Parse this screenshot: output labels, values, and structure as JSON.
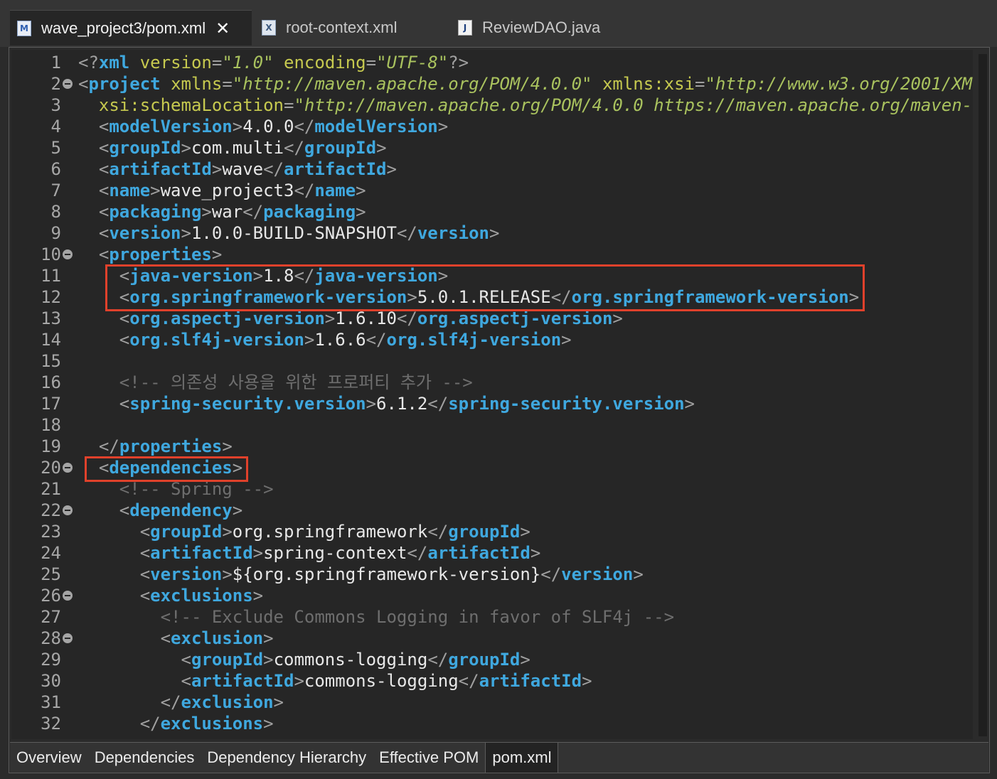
{
  "editor_tabs": [
    {
      "label": "wave_project3/pom.xml",
      "icon": "maven-pom-file-icon",
      "active": true,
      "closable": true
    },
    {
      "label": "root-context.xml",
      "icon": "xml-file-icon",
      "active": false
    },
    {
      "label": "ReviewDAO.java",
      "icon": "java-file-icon",
      "active": false
    }
  ],
  "tab_icon_letters": {
    "maven": "M",
    "xml": "X",
    "java": "J"
  },
  "close_glyph": "✕",
  "code_lines": [
    {
      "num": "1",
      "fold": false,
      "tokens": [
        [
          "p",
          "<?"
        ],
        [
          "tn",
          "xml"
        ],
        [
          "tx",
          " "
        ],
        [
          "an",
          "version"
        ],
        [
          "p",
          "="
        ],
        [
          "av",
          "\"1.0\""
        ],
        [
          "tx",
          " "
        ],
        [
          "an",
          "encoding"
        ],
        [
          "p",
          "="
        ],
        [
          "av",
          "\"UTF-8\""
        ],
        [
          "p",
          "?>"
        ]
      ]
    },
    {
      "num": "2",
      "fold": true,
      "tokens": [
        [
          "p",
          "<"
        ],
        [
          "tn",
          "project"
        ],
        [
          "tx",
          " "
        ],
        [
          "an",
          "xmlns"
        ],
        [
          "p",
          "="
        ],
        [
          "av",
          "\"http://maven.apache.org/POM/4.0.0\""
        ],
        [
          "tx",
          " "
        ],
        [
          "an",
          "xmlns:xsi"
        ],
        [
          "p",
          "="
        ],
        [
          "av",
          "\"http://www.w3.org/2001/XM"
        ]
      ]
    },
    {
      "num": "3",
      "fold": false,
      "tokens": [
        [
          "tx",
          "  "
        ],
        [
          "an",
          "xsi:schemaLocation"
        ],
        [
          "p",
          "="
        ],
        [
          "av",
          "\"http://maven.apache.org/POM/4.0.0 https://maven.apache.org/maven-"
        ]
      ]
    },
    {
      "num": "4",
      "fold": false,
      "tokens": [
        [
          "tx",
          "  "
        ],
        [
          "p",
          "<"
        ],
        [
          "tn",
          "modelVersion"
        ],
        [
          "p",
          ">"
        ],
        [
          "tx",
          "4.0.0"
        ],
        [
          "p",
          "</"
        ],
        [
          "tn",
          "modelVersion"
        ],
        [
          "p",
          ">"
        ]
      ]
    },
    {
      "num": "5",
      "fold": false,
      "tokens": [
        [
          "tx",
          "  "
        ],
        [
          "p",
          "<"
        ],
        [
          "tn",
          "groupId"
        ],
        [
          "p",
          ">"
        ],
        [
          "tx",
          "com.multi"
        ],
        [
          "p",
          "</"
        ],
        [
          "tn",
          "groupId"
        ],
        [
          "p",
          ">"
        ]
      ]
    },
    {
      "num": "6",
      "fold": false,
      "tokens": [
        [
          "tx",
          "  "
        ],
        [
          "p",
          "<"
        ],
        [
          "tn",
          "artifactId"
        ],
        [
          "p",
          ">"
        ],
        [
          "tx",
          "wave"
        ],
        [
          "p",
          "</"
        ],
        [
          "tn",
          "artifactId"
        ],
        [
          "p",
          ">"
        ]
      ]
    },
    {
      "num": "7",
      "fold": false,
      "tokens": [
        [
          "tx",
          "  "
        ],
        [
          "p",
          "<"
        ],
        [
          "tn",
          "name"
        ],
        [
          "p",
          ">"
        ],
        [
          "tx",
          "wave_project3"
        ],
        [
          "p",
          "</"
        ],
        [
          "tn",
          "name"
        ],
        [
          "p",
          ">"
        ]
      ]
    },
    {
      "num": "8",
      "fold": false,
      "tokens": [
        [
          "tx",
          "  "
        ],
        [
          "p",
          "<"
        ],
        [
          "tn",
          "packaging"
        ],
        [
          "p",
          ">"
        ],
        [
          "tx",
          "war"
        ],
        [
          "p",
          "</"
        ],
        [
          "tn",
          "packaging"
        ],
        [
          "p",
          ">"
        ]
      ]
    },
    {
      "num": "9",
      "fold": false,
      "tokens": [
        [
          "tx",
          "  "
        ],
        [
          "p",
          "<"
        ],
        [
          "tn",
          "version"
        ],
        [
          "p",
          ">"
        ],
        [
          "tx",
          "1.0.0-BUILD-SNAPSHOT"
        ],
        [
          "p",
          "</"
        ],
        [
          "tn",
          "version"
        ],
        [
          "p",
          ">"
        ]
      ]
    },
    {
      "num": "10",
      "fold": true,
      "tokens": [
        [
          "tx",
          "  "
        ],
        [
          "p",
          "<"
        ],
        [
          "tn",
          "properties"
        ],
        [
          "p",
          ">"
        ]
      ]
    },
    {
      "num": "11",
      "fold": false,
      "tokens": [
        [
          "tx",
          "    "
        ],
        [
          "p",
          "<"
        ],
        [
          "tn",
          "java-version"
        ],
        [
          "p",
          ">"
        ],
        [
          "tx",
          "1.8"
        ],
        [
          "p",
          "</"
        ],
        [
          "tn",
          "java-version"
        ],
        [
          "p",
          ">"
        ]
      ]
    },
    {
      "num": "12",
      "fold": false,
      "tokens": [
        [
          "tx",
          "    "
        ],
        [
          "p",
          "<"
        ],
        [
          "tn",
          "org.springframework-version"
        ],
        [
          "p",
          ">"
        ],
        [
          "tx",
          "5.0.1.RELEASE"
        ],
        [
          "p",
          "</"
        ],
        [
          "tn",
          "org.springframework-version"
        ],
        [
          "p",
          ">"
        ]
      ]
    },
    {
      "num": "13",
      "fold": false,
      "tokens": [
        [
          "tx",
          "    "
        ],
        [
          "p",
          "<"
        ],
        [
          "tn",
          "org.aspectj-version"
        ],
        [
          "p",
          ">"
        ],
        [
          "tx",
          "1.6.10"
        ],
        [
          "p",
          "</"
        ],
        [
          "tn",
          "org.aspectj-version"
        ],
        [
          "p",
          ">"
        ]
      ]
    },
    {
      "num": "14",
      "fold": false,
      "tokens": [
        [
          "tx",
          "    "
        ],
        [
          "p",
          "<"
        ],
        [
          "tn",
          "org.slf4j-version"
        ],
        [
          "p",
          ">"
        ],
        [
          "tx",
          "1.6.6"
        ],
        [
          "p",
          "</"
        ],
        [
          "tn",
          "org.slf4j-version"
        ],
        [
          "p",
          ">"
        ]
      ]
    },
    {
      "num": "15",
      "fold": false,
      "tokens": []
    },
    {
      "num": "16",
      "fold": false,
      "tokens": [
        [
          "tx",
          "    "
        ],
        [
          "cm",
          "<!-- 의존성 사용을 위한 프로퍼티 추가 -->"
        ]
      ]
    },
    {
      "num": "17",
      "fold": false,
      "tokens": [
        [
          "tx",
          "    "
        ],
        [
          "p",
          "<"
        ],
        [
          "tn",
          "spring-security.version"
        ],
        [
          "p",
          ">"
        ],
        [
          "tx",
          "6.1.2"
        ],
        [
          "p",
          "</"
        ],
        [
          "tn",
          "spring-security.version"
        ],
        [
          "p",
          ">"
        ]
      ]
    },
    {
      "num": "18",
      "fold": false,
      "tokens": []
    },
    {
      "num": "19",
      "fold": false,
      "tokens": [
        [
          "tx",
          "  "
        ],
        [
          "p",
          "</"
        ],
        [
          "tn",
          "properties"
        ],
        [
          "p",
          ">"
        ]
      ]
    },
    {
      "num": "20",
      "fold": true,
      "tokens": [
        [
          "tx",
          "  "
        ],
        [
          "p",
          "<"
        ],
        [
          "tn",
          "dependencies"
        ],
        [
          "p",
          ">"
        ]
      ]
    },
    {
      "num": "21",
      "fold": false,
      "tokens": [
        [
          "tx",
          "    "
        ],
        [
          "cm",
          "<!-- Spring -->"
        ]
      ]
    },
    {
      "num": "22",
      "fold": true,
      "tokens": [
        [
          "tx",
          "    "
        ],
        [
          "p",
          "<"
        ],
        [
          "tn",
          "dependency"
        ],
        [
          "p",
          ">"
        ]
      ]
    },
    {
      "num": "23",
      "fold": false,
      "tokens": [
        [
          "tx",
          "      "
        ],
        [
          "p",
          "<"
        ],
        [
          "tn",
          "groupId"
        ],
        [
          "p",
          ">"
        ],
        [
          "tx",
          "org.springframework"
        ],
        [
          "p",
          "</"
        ],
        [
          "tn",
          "groupId"
        ],
        [
          "p",
          ">"
        ]
      ]
    },
    {
      "num": "24",
      "fold": false,
      "tokens": [
        [
          "tx",
          "      "
        ],
        [
          "p",
          "<"
        ],
        [
          "tn",
          "artifactId"
        ],
        [
          "p",
          ">"
        ],
        [
          "tx",
          "spring-context"
        ],
        [
          "p",
          "</"
        ],
        [
          "tn",
          "artifactId"
        ],
        [
          "p",
          ">"
        ]
      ]
    },
    {
      "num": "25",
      "fold": false,
      "tokens": [
        [
          "tx",
          "      "
        ],
        [
          "p",
          "<"
        ],
        [
          "tn",
          "version"
        ],
        [
          "p",
          ">"
        ],
        [
          "tx",
          "${org.springframework-version}"
        ],
        [
          "p",
          "</"
        ],
        [
          "tn",
          "version"
        ],
        [
          "p",
          ">"
        ]
      ]
    },
    {
      "num": "26",
      "fold": true,
      "tokens": [
        [
          "tx",
          "      "
        ],
        [
          "p",
          "<"
        ],
        [
          "tn",
          "exclusions"
        ],
        [
          "p",
          ">"
        ]
      ]
    },
    {
      "num": "27",
      "fold": false,
      "tokens": [
        [
          "tx",
          "        "
        ],
        [
          "cm",
          "<!-- Exclude Commons Logging in favor of SLF4j -->"
        ]
      ]
    },
    {
      "num": "28",
      "fold": true,
      "tokens": [
        [
          "tx",
          "        "
        ],
        [
          "p",
          "<"
        ],
        [
          "tn",
          "exclusion"
        ],
        [
          "p",
          ">"
        ]
      ]
    },
    {
      "num": "29",
      "fold": false,
      "tokens": [
        [
          "tx",
          "          "
        ],
        [
          "p",
          "<"
        ],
        [
          "tn",
          "groupId"
        ],
        [
          "p",
          ">"
        ],
        [
          "tx",
          "commons-logging"
        ],
        [
          "p",
          "</"
        ],
        [
          "tn",
          "groupId"
        ],
        [
          "p",
          ">"
        ]
      ]
    },
    {
      "num": "30",
      "fold": false,
      "tokens": [
        [
          "tx",
          "          "
        ],
        [
          "p",
          "<"
        ],
        [
          "tn",
          "artifactId"
        ],
        [
          "p",
          ">"
        ],
        [
          "tx",
          "commons-logging"
        ],
        [
          "p",
          "</"
        ],
        [
          "tn",
          "artifactId"
        ],
        [
          "p",
          ">"
        ]
      ]
    },
    {
      "num": "31",
      "fold": false,
      "tokens": [
        [
          "tx",
          "        "
        ],
        [
          "p",
          "</"
        ],
        [
          "tn",
          "exclusion"
        ],
        [
          "p",
          ">"
        ]
      ]
    },
    {
      "num": "32",
      "fold": false,
      "tokens": [
        [
          "tx",
          "      "
        ],
        [
          "p",
          "</"
        ],
        [
          "tn",
          "exclusions"
        ],
        [
          "p",
          ">"
        ]
      ]
    }
  ],
  "highlights": [
    {
      "label": "version-properties-highlight",
      "lines": [
        "11",
        "12"
      ]
    },
    {
      "label": "dependencies-tag-highlight",
      "lines": [
        "20"
      ]
    }
  ],
  "page_tabs": [
    {
      "label": "Overview",
      "active": false
    },
    {
      "label": "Dependencies",
      "active": false
    },
    {
      "label": "Dependency Hierarchy",
      "active": false
    },
    {
      "label": "Effective POM",
      "active": false
    },
    {
      "label": "pom.xml",
      "active": true
    }
  ],
  "colors": {
    "tag": "#3fa8df",
    "attribute_name": "#c6c94f",
    "attribute_value": "#a9c25e",
    "text": "#e8e8e8",
    "comment": "#6e6e6e",
    "punctuation": "#a0a0a0",
    "highlight_box": "#e0412b",
    "editor_background": "#262626"
  }
}
